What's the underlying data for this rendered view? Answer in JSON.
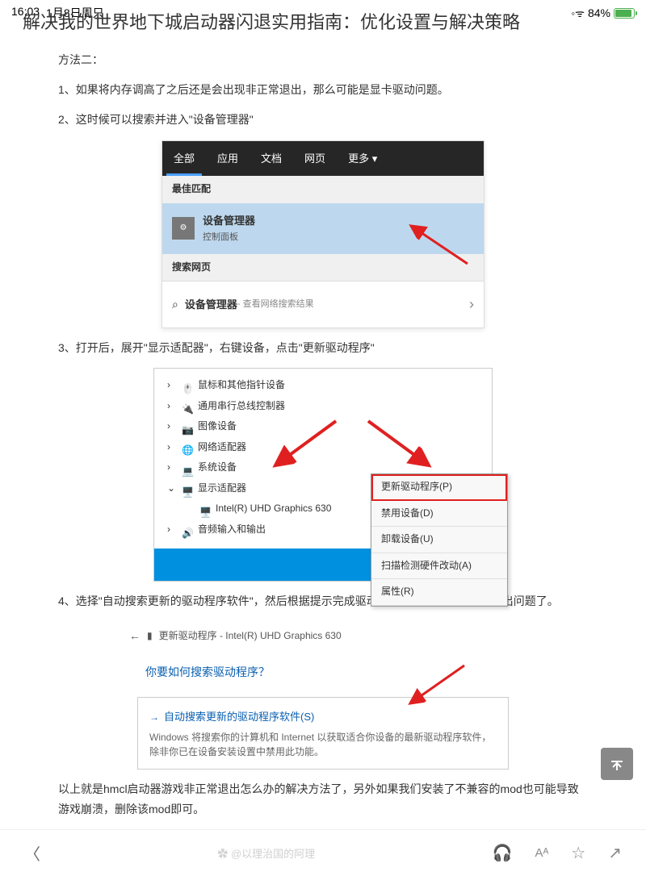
{
  "status": {
    "time": "16:03",
    "date": "1月8日周只",
    "battery": "84%"
  },
  "title": "解决我的世界地下城启动器闪退实用指南：优化设置与解决策略",
  "p0": "方法二：",
  "p1": "1、如果将内存调高了之后还是会出现非正常退出，那么可能是显卡驱动问题。",
  "p2": "2、这时候可以搜索并进入\"设备管理器\"",
  "p3": "3、打开后，展开\"显示适配器\"，右键设备，点击\"更新驱动程序\"",
  "p4": "4、选择\"自动搜索更新的驱动程序软件\"，然后根据提示完成驱动更新就可以解决非正常退出问题了。",
  "p5": "以上就是hmcl启动器游戏非正常退出怎么办的解决方法了，另外如果我们安装了不兼容的mod也可能导致游戏崩溃，删除该mod即可。",
  "search": {
    "tabs": [
      "全部",
      "应用",
      "文档",
      "网页",
      "更多"
    ],
    "bestMatch": "最佳匹配",
    "resTitle": "设备管理器",
    "resSub": "控制面板",
    "webHdr": "搜索网页",
    "netMain": "设备管理器",
    "netSub": " - 查看网络搜索结果"
  },
  "dm": {
    "items": [
      "鼠标和其他指针设备",
      "通用串行总线控制器",
      "图像设备",
      "网络适配器",
      "系统设备",
      "显示适配器"
    ],
    "gpu": "Intel(R) UHD Graphics 630",
    "audio": "音频输入和输出",
    "menu": [
      "更新驱动程序(P)",
      "禁用设备(D)",
      "卸载设备(U)",
      "扫描检测硬件改动(A)",
      "属性(R)"
    ]
  },
  "upd": {
    "hdr": "更新驱动程序 - Intel(R) UHD Graphics 630",
    "q": "你要如何搜索驱动程序？",
    "optT": "自动搜索更新的驱动程序软件(S)",
    "optD": "Windows 将搜索你的计算机和 Internet 以获取适合你设备的最新驱动程序软件，除非你已在设备安装设置中禁用此功能。"
  },
  "watermark": "✿ @以理治国的阿理"
}
